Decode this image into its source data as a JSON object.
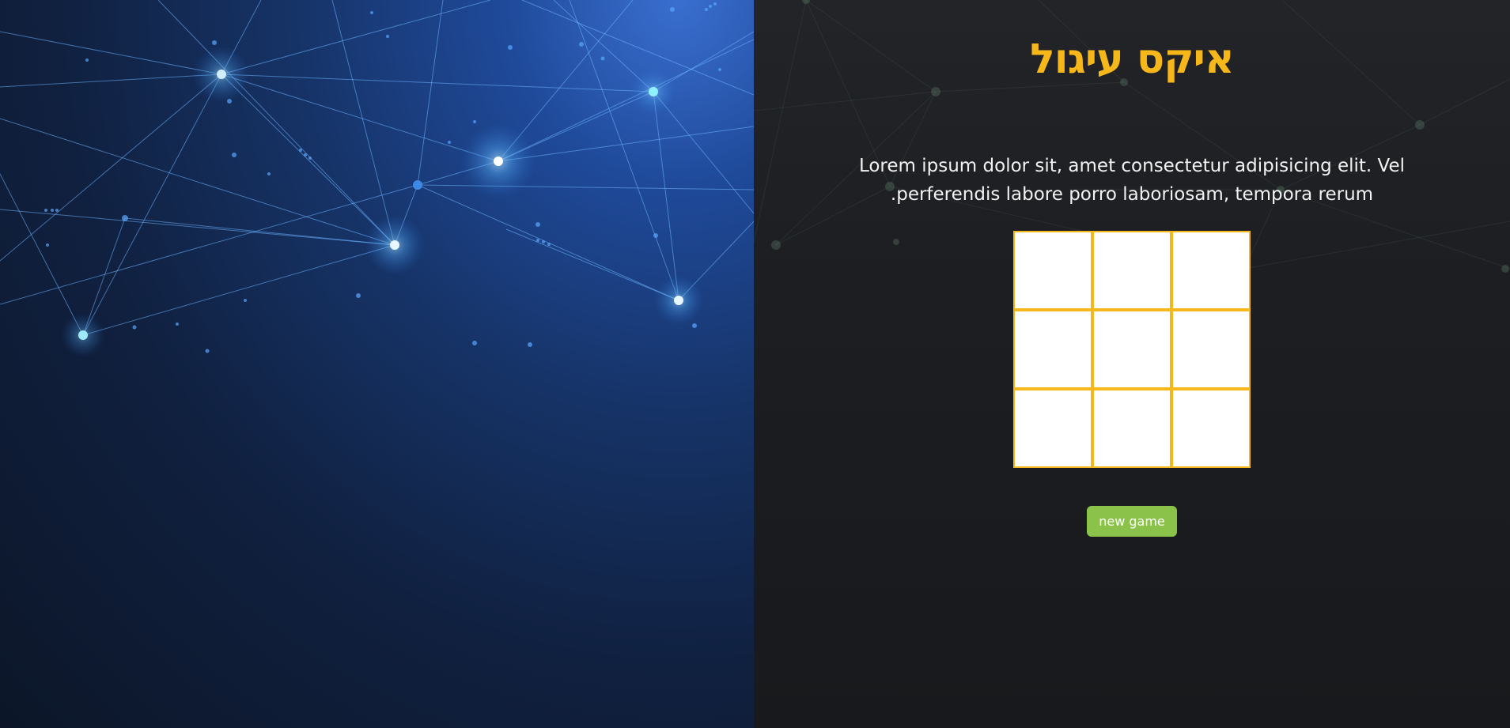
{
  "header": {
    "title": "איקס עיגול"
  },
  "intro": {
    "text": "Lorem ipsum dolor sit, amet consectetur adipisicing elit. Vel perferendis labore porro laboriosam, tempora rerum."
  },
  "board": {
    "cells": [
      "",
      "",
      "",
      "",
      "",
      "",
      "",
      "",
      ""
    ]
  },
  "controls": {
    "new_game_label": "new game"
  },
  "colors": {
    "accent": "#f6b71a",
    "button": "#8bc34a",
    "cell": "#ffffff",
    "background": "#1a1c20"
  }
}
